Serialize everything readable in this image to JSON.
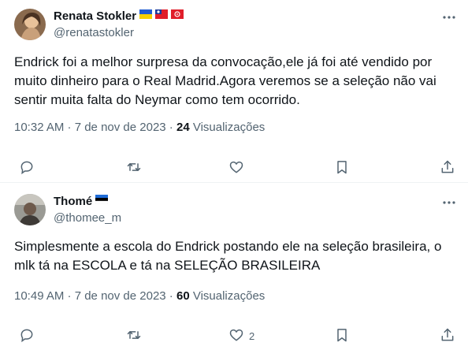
{
  "tweets": [
    {
      "name": "Renata Stokler",
      "handle": "@renatastokler",
      "text": "Endrick foi a melhor surpresa da convocação,ele já foi até vendido por muito dinheiro para o Real Madrid.Agora veremos se a seleção não vai sentir muita falta do Neymar como tem ocorrido.",
      "time": "10:32 AM · 7 de nov de 2023 ·",
      "views_count": "24",
      "views_label": "Visualizações",
      "flags": [
        "ukraine-flag-icon",
        "taiwan-flag-icon",
        "hong-kong-flag-icon"
      ],
      "actions": {
        "reply": "",
        "retweet": "",
        "like": "",
        "bookmark": "",
        "share": ""
      }
    },
    {
      "name": "Thomé",
      "handle": "@thomee_m",
      "text": "Simplesmente a escola do Endrick postando ele na seleção brasileira, o mlk tá na ESCOLA e tá na SELEÇÃO BRASILEIRA",
      "time": "10:49 AM · 7 de nov de 2023 ·",
      "views_count": "60",
      "views_label": "Visualizações",
      "flags": [
        "estonia-flag-icon"
      ],
      "actions": {
        "reply": "",
        "retweet": "",
        "like": "2",
        "bookmark": "",
        "share": ""
      }
    }
  ],
  "colors": {
    "text": "#0f1419",
    "muted": "#536471",
    "divider": "#eff3f4"
  }
}
